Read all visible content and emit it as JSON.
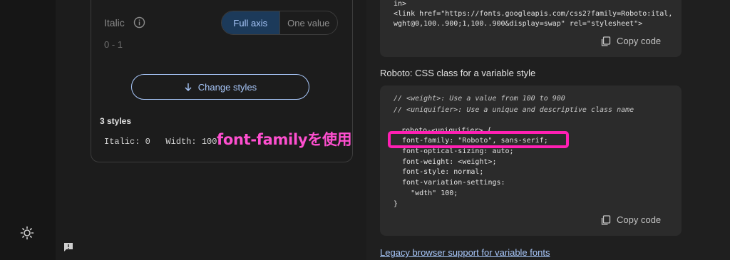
{
  "italic_axis": {
    "label": "Italic",
    "range": "0 - 1",
    "toggle": {
      "full_axis": "Full axis",
      "one_value": "One value",
      "selected": "Full axis"
    }
  },
  "change_styles_label": "Change styles",
  "styles_summary": {
    "count": "3 styles",
    "values": "Italic: 0   Width: 100"
  },
  "annotation": "font-familyを使用",
  "embed_code": {
    "lines": [
      "in>",
      "<link href=\"https://fonts.googleapis.com/css2?family=Roboto:ital,",
      "wght@0,100..900;1,100..900&display=swap\" rel=\"stylesheet\">"
    ],
    "copy_label": "Copy code"
  },
  "css_class_section": {
    "title": "Roboto: CSS class for a variable style",
    "lines": [
      "// <weight>: Use a value from 100 to 900",
      "// <uniquifier>: Use a unique and descriptive class name",
      ".roboto-<uniquifier> {",
      "  font-family: \"Roboto\", sans-serif;",
      "  font-optical-sizing: auto;",
      "  font-weight: <weight>;",
      "  font-style: normal;",
      "  font-variation-settings:",
      "    \"wdth\" 100;",
      "}"
    ],
    "copy_label": "Copy code"
  },
  "legacy_link": "Legacy browser support for variable fonts",
  "colors": {
    "accent": "#a8c7fa",
    "highlight": "#ff1fb3",
    "annotation": "#ff4fd0"
  },
  "icons": [
    "sun-icon",
    "feedback-icon",
    "info-icon",
    "arrow-down-icon",
    "copy-icon"
  ]
}
